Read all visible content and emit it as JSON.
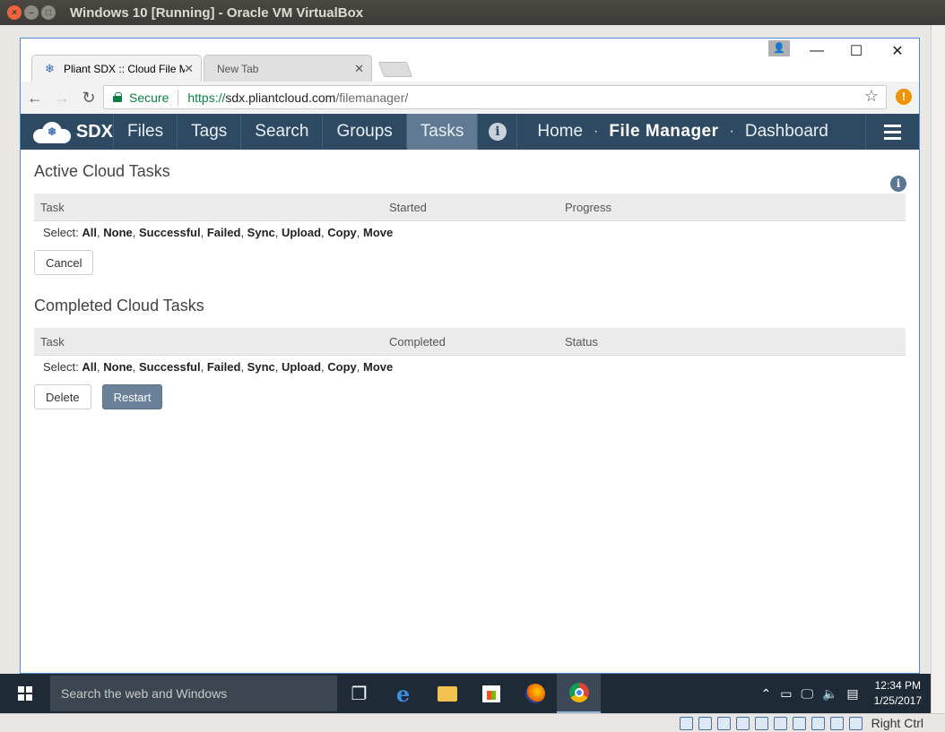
{
  "vbox": {
    "title": "Windows 10 [Running] - Oracle VM VirtualBox",
    "host_key": "Right Ctrl"
  },
  "browser": {
    "tabs": [
      {
        "title": "Pliant SDX :: Cloud File Manager",
        "active": true
      },
      {
        "title": "New Tab",
        "active": false
      }
    ],
    "secure_label": "Secure",
    "url_scheme": "https://",
    "url_host": "sdx.pliantcloud.com",
    "url_path": "/filemanager/"
  },
  "app_nav": {
    "brand": "SDX",
    "tabs": [
      "Files",
      "Tags",
      "Search",
      "Groups",
      "Tasks"
    ],
    "active_tab": "Tasks",
    "right_links": [
      "Home",
      "File Manager",
      "Dashboard"
    ],
    "separator": "·"
  },
  "active_tasks": {
    "title": "Active Cloud Tasks",
    "columns": [
      "Task",
      "Started",
      "Progress"
    ],
    "select_prefix": "Select:",
    "select_options": [
      "All",
      "None",
      "Successful",
      "Failed",
      "Sync",
      "Upload",
      "Copy",
      "Move"
    ],
    "cancel_label": "Cancel"
  },
  "completed_tasks": {
    "title": "Completed Cloud Tasks",
    "columns": [
      "Task",
      "Completed",
      "Status"
    ],
    "select_prefix": "Select:",
    "select_options": [
      "All",
      "None",
      "Successful",
      "Failed",
      "Sync",
      "Upload",
      "Copy",
      "Move"
    ],
    "delete_label": "Delete",
    "restart_label": "Restart"
  },
  "taskbar": {
    "search_placeholder": "Search the web and Windows",
    "time": "12:34 PM",
    "date": "1/25/2017"
  },
  "colors": {
    "navbar": "#2e4a62",
    "active_tab": "#5f7a92",
    "restart_button": "#6a8299",
    "secure_green": "#0b8043"
  }
}
